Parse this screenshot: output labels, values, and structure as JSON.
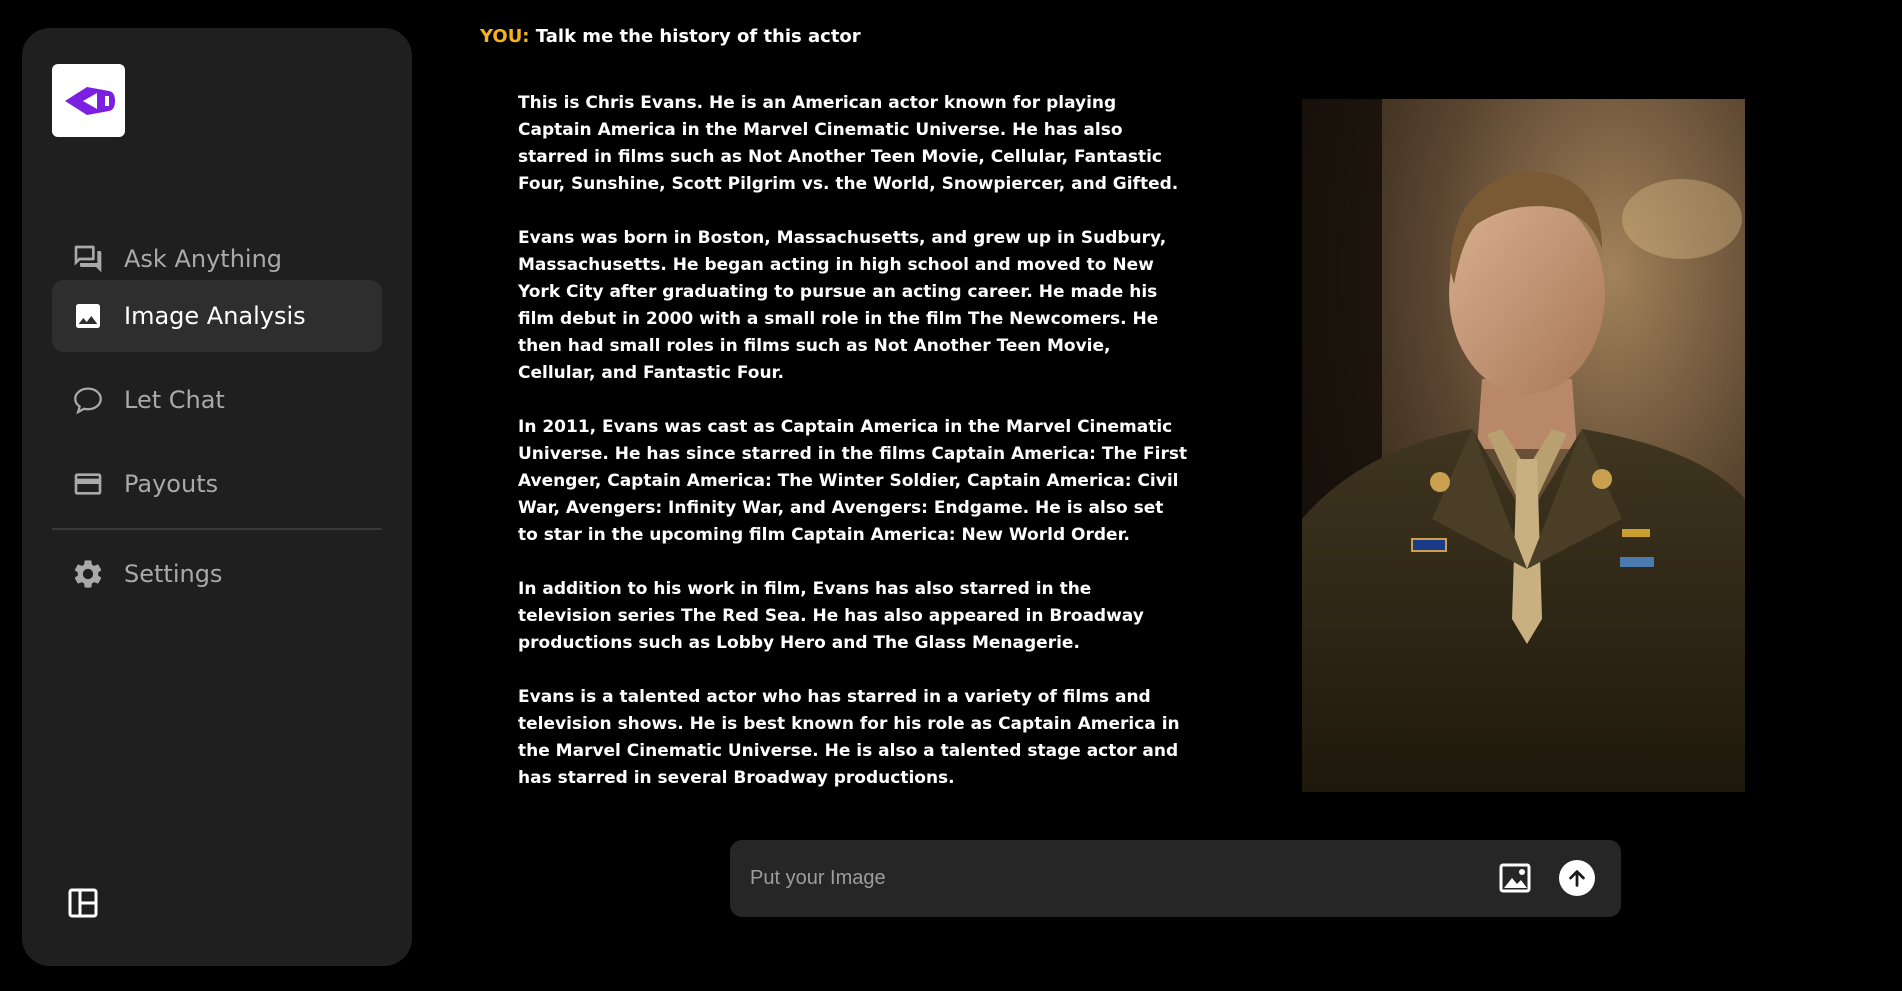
{
  "app": {
    "brand_color": "#7b1fe0",
    "accent_color": "#f6b21b"
  },
  "sidebar": {
    "logo_icon": "megaphone-logo-icon",
    "items": [
      {
        "label": "Ask Anything",
        "icon": "forum-icon",
        "active": false
      },
      {
        "label": "Image Analysis",
        "icon": "image-icon",
        "active": true
      },
      {
        "label": "Let Chat",
        "icon": "chat-bubble-icon",
        "active": false
      },
      {
        "label": "Payouts",
        "icon": "credit-card-icon",
        "active": false
      },
      {
        "label": "Settings",
        "icon": "gear-icon",
        "active": false
      }
    ],
    "layout_toggle_icon": "layout-panel-icon"
  },
  "conversation": {
    "prompt_prefix": "YOU:",
    "prompt_text": "Talk me the history of this actor",
    "answer_paragraphs": [
      "This is Chris Evans. He is an American actor known for playing Captain America in the Marvel Cinematic Universe. He has also starred in films such as Not Another Teen Movie, Cellular, Fantastic Four, Sunshine, Scott Pilgrim vs. the World, Snowpiercer, and Gifted.",
      "Evans was born in Boston, Massachusetts, and grew up in Sudbury, Massachusetts. He began acting in high school and moved to New York City after graduating to pursue an acting career. He made his film debut in 2000 with a small role in the film The Newcomers. He then had small roles in films such as Not Another Teen Movie, Cellular, and Fantastic Four.",
      "In 2011, Evans was cast as Captain America in the Marvel Cinematic Universe. He has since starred in the films Captain America: The First Avenger, Captain America: The Winter Soldier, Captain America: Civil War, Avengers: Infinity War, and Avengers: Endgame. He is also set to star in the upcoming film Captain America: New World Order.",
      "In addition to his work in film, Evans has also starred in the television series The Red Sea. He has also appeared in Broadway productions such as Lobby Hero and The Glass Menagerie.",
      "Evans is a talented actor who has starred in a variety of films and television shows. He is best known for his role as Captain America in the Marvel Cinematic Universe. He is also a talented stage actor and has starred in several Broadway productions."
    ],
    "uploaded_image": "actor-portrait-image"
  },
  "composer": {
    "placeholder": "Put your Image",
    "value": "",
    "image_button_icon": "image-upload-icon",
    "send_button_icon": "arrow-up-icon"
  }
}
